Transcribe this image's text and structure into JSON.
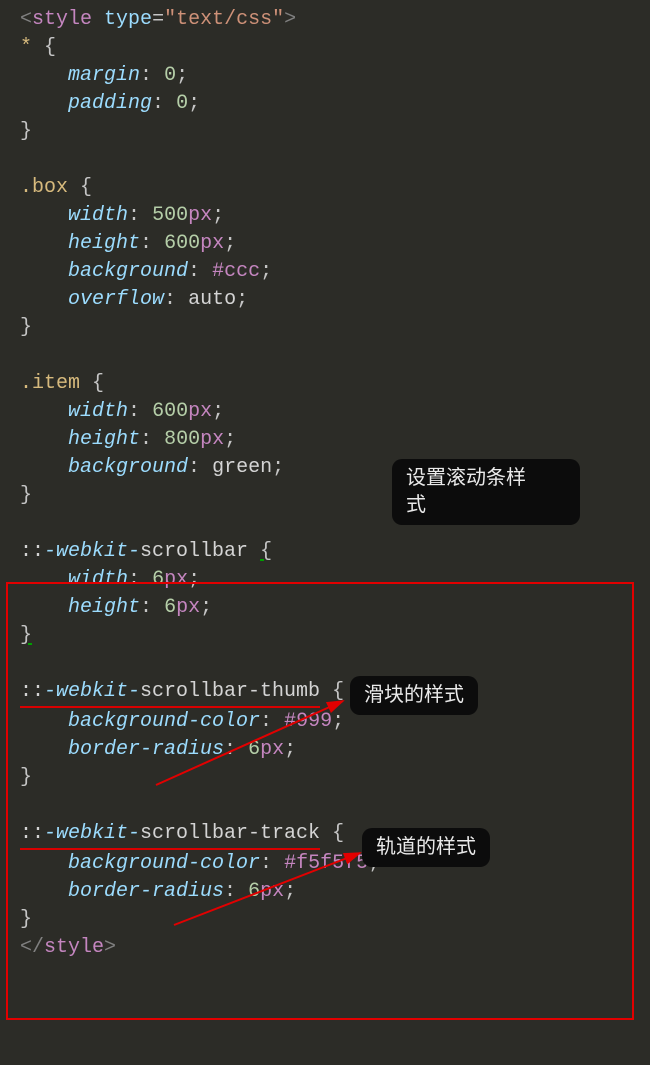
{
  "code": {
    "l1": {
      "lt": "<",
      "tag": "style",
      "sp": " ",
      "attr": "type",
      "eq": "=",
      "q1": "\"",
      "str": "text/css",
      "q2": "\"",
      "gt": ">"
    },
    "l2": {
      "sel": "*",
      "sp": " ",
      "brace": "{"
    },
    "l3": {
      "indent": "    ",
      "prop": "margin",
      "colon": ":",
      "sp": " ",
      "num": "0",
      "semi": ";"
    },
    "l4": {
      "indent": "    ",
      "prop": "padding",
      "colon": ":",
      "sp": " ",
      "num": "0",
      "semi": ";"
    },
    "l5": {
      "brace": "}"
    },
    "l6": "",
    "l7": {
      "sel": ".box",
      "sp": " ",
      "brace": "{"
    },
    "l8": {
      "indent": "    ",
      "prop": "width",
      "colon": ":",
      "sp": " ",
      "num": "500",
      "unit": "px",
      "semi": ";"
    },
    "l9": {
      "indent": "    ",
      "prop": "height",
      "colon": ":",
      "sp": " ",
      "num": "600",
      "unit": "px",
      "semi": ";"
    },
    "l10": {
      "indent": "    ",
      "prop": "background",
      "colon": ":",
      "sp": " ",
      "hex": "#ccc",
      "semi": ";"
    },
    "l11": {
      "indent": "    ",
      "prop": "overflow",
      "colon": ":",
      "sp": " ",
      "val": "auto",
      "semi": ";"
    },
    "l12": {
      "brace": "}"
    },
    "l13": "",
    "l14": {
      "sel": ".item",
      "sp": " ",
      "brace": "{"
    },
    "l15": {
      "indent": "    ",
      "prop": "width",
      "colon": ":",
      "sp": " ",
      "num": "600",
      "unit": "px",
      "semi": ";"
    },
    "l16": {
      "indent": "    ",
      "prop": "height",
      "colon": ":",
      "sp": " ",
      "num": "800",
      "unit": "px",
      "semi": ";"
    },
    "l17": {
      "indent": "    ",
      "prop": "background",
      "colon": ":",
      "sp": " ",
      "val": "green",
      "semi": ";"
    },
    "l18": {
      "brace": "}"
    },
    "l19": "",
    "l20": {
      "colon2": "::",
      "webkit": "-webkit-",
      "name": "scrollbar",
      "sp": " ",
      "brace": "{"
    },
    "l21": {
      "indent": "    ",
      "prop": "width",
      "colon": ":",
      "sp": " ",
      "num": "6",
      "unit": "px",
      "semi": ";"
    },
    "l22": {
      "indent": "    ",
      "prop": "height",
      "colon": ":",
      "sp": " ",
      "num": "6",
      "unit": "px",
      "semi": ";"
    },
    "l23": {
      "brace": "}"
    },
    "l24": "",
    "l25": {
      "colon2": "::",
      "webkit": "-webkit-",
      "name": "scrollbar-thumb",
      "sp": " ",
      "brace": "{"
    },
    "l26": {
      "indent": "    ",
      "prop": "background-color",
      "colon": ":",
      "sp": " ",
      "hex": "#999",
      "semi": ";"
    },
    "l27": {
      "indent": "    ",
      "prop": "border-radius",
      "colon": ":",
      "sp": " ",
      "num": "6",
      "unit": "px",
      "semi": ";"
    },
    "l28": {
      "brace": "}"
    },
    "l29": "",
    "l30": {
      "colon2": "::",
      "webkit": "-webkit-",
      "name": "scrollbar-track",
      "sp": " ",
      "brace": "{"
    },
    "l31": {
      "indent": "    ",
      "prop": "background-color",
      "colon": ":",
      "sp": " ",
      "hex": "#f5f5f5",
      "semi": ";"
    },
    "l32": {
      "indent": "    ",
      "prop": "border-radius",
      "colon": ":",
      "sp": " ",
      "num": "6",
      "unit": "px",
      "semi": ";"
    },
    "l33": {
      "brace": "}"
    },
    "l34": {
      "lt": "</",
      "tag": "style",
      "gt": ">"
    }
  },
  "bubbles": {
    "b1_l1": "设置滚动条样",
    "b1_l2": "式",
    "b2": "滑块的样式",
    "b3": "轨道的样式"
  }
}
